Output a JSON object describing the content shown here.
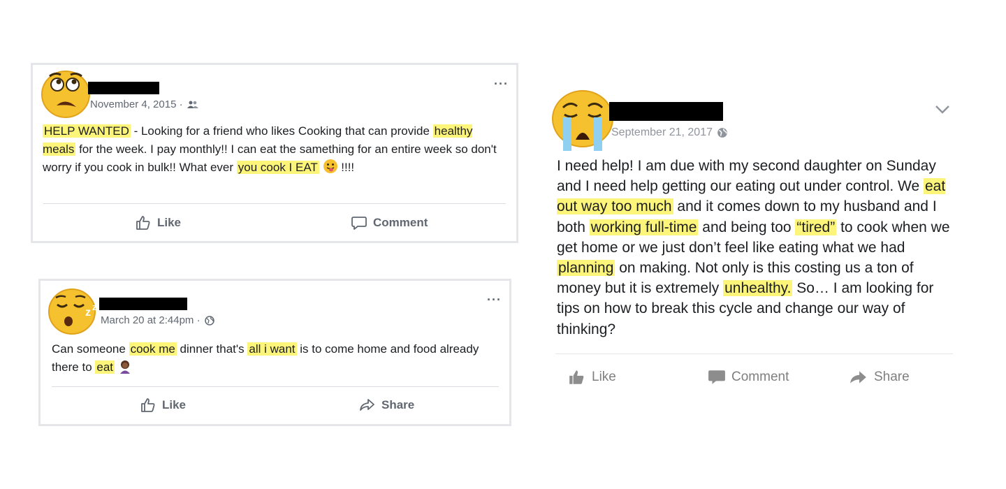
{
  "post1": {
    "date": "November 4, 2015 ·",
    "text": [
      {
        "t": "HELP WANTED",
        "h": true
      },
      {
        "t": " - Looking for a friend who likes Cooking that can provide ",
        "h": false
      },
      {
        "t": "healthy meals",
        "h": true
      },
      {
        "t": " for the week. I pay monthly!! I can eat the samething for an entire week so don't worry if you cook in bulk!! What ever ",
        "h": false
      },
      {
        "t": "you cook I EAT",
        "h": true
      },
      {
        "t": "EMOJI",
        "h": false
      },
      {
        "t": " !!!!",
        "h": false
      }
    ],
    "more": "···",
    "like_label": "Like",
    "comment_label": "Comment",
    "audience_icon": "friends-icon",
    "avatar_icon": "worried-face-icon"
  },
  "post2": {
    "date": "March 20 at 2:44pm ·",
    "text": [
      {
        "t": "Can someone ",
        "h": false
      },
      {
        "t": "cook me",
        "h": true
      },
      {
        "t": " dinner that's ",
        "h": false
      },
      {
        "t": "all i want",
        "h": true
      },
      {
        "t": " is to come home and food already there to ",
        "h": false
      },
      {
        "t": "eat",
        "h": true
      },
      {
        "t": "EMOJI",
        "h": false
      }
    ],
    "more": "···",
    "like_label": "Like",
    "share_label": "Share",
    "audience_icon": "globe-icon",
    "avatar_icon": "sleeping-face-icon"
  },
  "post3": {
    "date": "September 21, 2017",
    "text": [
      {
        "t": "I need help! I am due with my second daughter on Sunday and I need help getting our eating out under control. We ",
        "h": false
      },
      {
        "t": "eat out way too much",
        "h": true
      },
      {
        "t": " and it comes down to my husband and I both ",
        "h": false
      },
      {
        "t": "working full-time",
        "h": true
      },
      {
        "t": " and being too ",
        "h": false
      },
      {
        "t": "“tired”",
        "h": true
      },
      {
        "t": " to cook when we get home or we just don’t feel like eating what we had ",
        "h": false
      },
      {
        "t": "planning",
        "h": true
      },
      {
        "t": " on making. Not only is this costing us a ton of money but it is extremely ",
        "h": false
      },
      {
        "t": "unhealthy.",
        "h": true
      },
      {
        "t": " So… I am looking for tips on how to break this cycle and change our way of thinking?",
        "h": false
      }
    ],
    "like_label": "Like",
    "comment_label": "Comment",
    "share_label": "Share",
    "audience_icon": "globe-icon",
    "avatar_icon": "crying-face-icon",
    "menu_icon": "chevron-down-icon"
  },
  "colors": {
    "highlight": "#fdf57a",
    "emoji_yellow": "#f6c12e",
    "tears": "#8fd0f0"
  }
}
